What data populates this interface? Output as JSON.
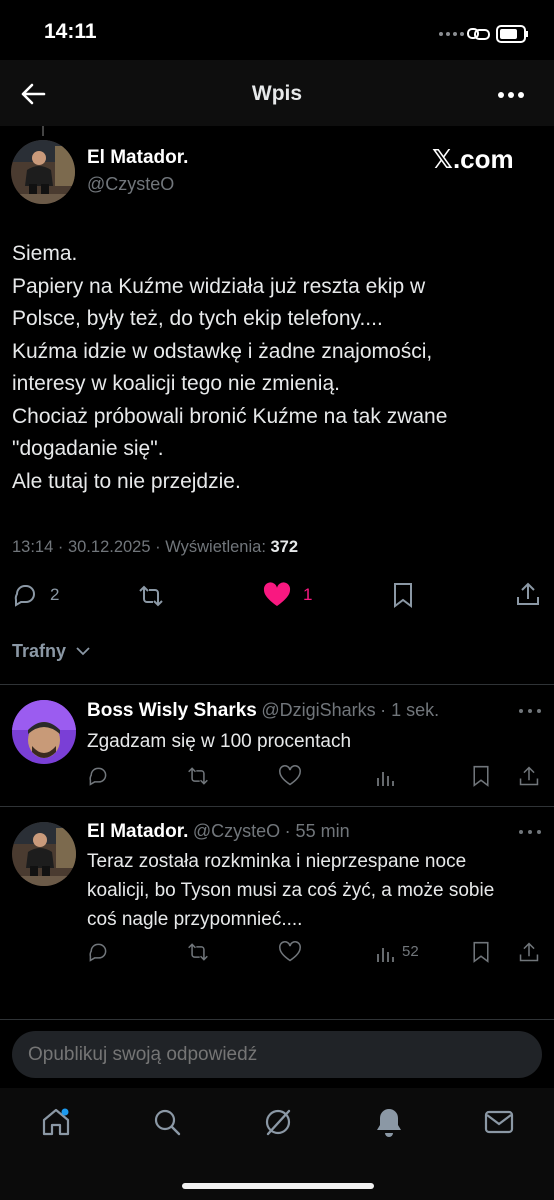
{
  "status": {
    "time": "14:11"
  },
  "header": {
    "title": "Wpis"
  },
  "post": {
    "name": "El Matador.",
    "handle": "@CzysteO",
    "watermark": "𝕏.com",
    "text": "Siema.\nPapiery na Kuźme widziała już reszta ekip w\nPolsce, były też, do tych ekip telefony....\nKuźma idzie w odstawkę i żadne znajomości,\ninteresy w koalicji tego nie zmienią.\nChociaż próbowali bronić Kuźme na tak zwane\n\"dogadanie się\".\nAle tutaj to nie przejdzie.",
    "timestamp": "13:14 · 30.12.2025 · Wyświetlenia: ",
    "views": "372",
    "replies": "2",
    "likes": "1"
  },
  "sort": {
    "label": "Trafny"
  },
  "replies": [
    {
      "name": "Boss Wisly Sharks",
      "handle": "@DzigiSharks",
      "time": "· 1 sek.",
      "text": "Zgadzam się w 100 procentach",
      "views": ""
    },
    {
      "name": "El Matador.",
      "handle": "@CzysteO",
      "time": "· 55 min",
      "text": "Teraz została rozkminka i nieprzespane noce\nkoalicji, bo Tyson musi za coś żyć, a może sobie\ncoś nagle przypomnieć....",
      "views": "52"
    }
  ],
  "composer": {
    "placeholder": "Opublikuj swoją odpowiedź"
  },
  "colors": {
    "like": "#f91880",
    "background": "#000000",
    "text": "#e7e9ea",
    "muted": "#71767b",
    "accent_dot": "#1d9bf0"
  },
  "nav": {
    "icons": [
      "home-icon",
      "search-icon",
      "grok-icon",
      "notifications-icon",
      "messages-icon"
    ]
  }
}
